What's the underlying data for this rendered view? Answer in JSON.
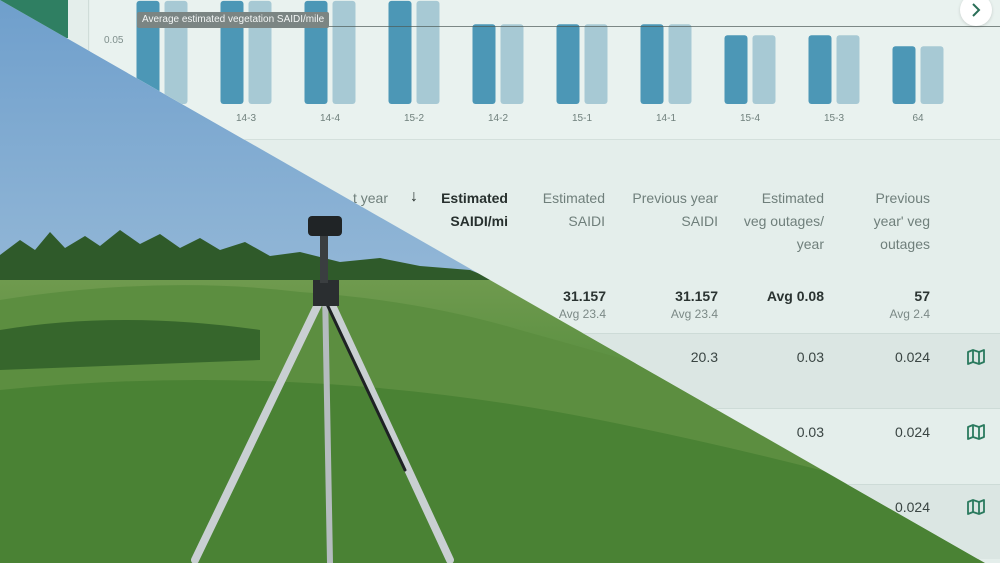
{
  "chart": {
    "ytick": "0.05",
    "reference_label": "Average estimated vegetation SAIDI/mile",
    "chart_data": {
      "type": "bar",
      "categories": [
        "",
        "14-3",
        "14-4",
        "15-2",
        "14-2",
        "15-1",
        "14-1",
        "15-4",
        "15-3",
        "64",
        ""
      ],
      "series": [
        {
          "values": [
            0.075,
            0.075,
            0.075,
            0.075,
            0.058,
            0.058,
            0.058,
            0.05,
            0.05,
            0.042,
            null
          ]
        },
        {
          "values": [
            0.075,
            0.075,
            0.075,
            0.075,
            0.058,
            0.058,
            0.058,
            0.05,
            0.05,
            0.042,
            0.042
          ]
        }
      ],
      "reference_value": 0.06,
      "ylim": [
        0,
        0.08
      ],
      "grid": false
    },
    "colors": {
      "primary": "#4c97b6",
      "secondary": "#a7c9d4"
    }
  },
  "table": {
    "headers": [
      {
        "line1": "t year",
        "line2": ""
      },
      {
        "line1": "Estimated",
        "line2": "SAIDI/mi"
      },
      {
        "line1": "Estimated",
        "line2": "SAIDI"
      },
      {
        "line1": "Previous year",
        "line2": "SAIDI"
      },
      {
        "line1": "Estimated",
        "line2": "veg outages/",
        "line3": "year"
      },
      {
        "line1": "Previous",
        "line2": "year' veg",
        "line3": "outages"
      }
    ],
    "sort_arrow": "↓",
    "summary": [
      {
        "value": "31.157",
        "avg": "Avg 23.4"
      },
      {
        "value": "31.157",
        "avg": "Avg 23.4"
      },
      {
        "value": "Avg 0.08",
        "avg": ""
      },
      {
        "value": "57",
        "avg": "Avg 2.4"
      }
    ],
    "rows": [
      {
        "c1": "20.3",
        "c2": "0.03",
        "c3": "0.024"
      },
      {
        "c1": "",
        "c2": "0.03",
        "c3": "0.024"
      },
      {
        "c1": "",
        "c2": "",
        "c3": "0.024"
      }
    ]
  },
  "icons": {
    "next": "chevron-right-icon",
    "map": "map-icon"
  }
}
